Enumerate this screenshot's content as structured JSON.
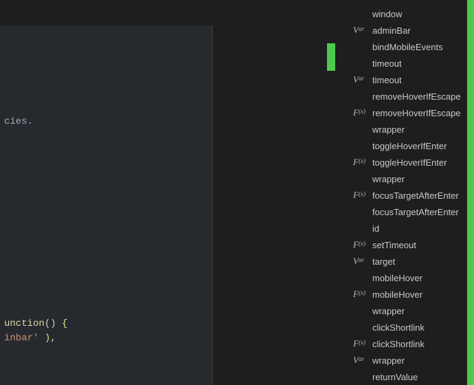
{
  "editor": {
    "lines": [
      {
        "text": "",
        "cls": ""
      },
      {
        "text": "",
        "cls": ""
      },
      {
        "text": "",
        "cls": ""
      },
      {
        "text": "",
        "cls": ""
      },
      {
        "text": "",
        "cls": ""
      },
      {
        "text": "",
        "cls": ""
      },
      {
        "text": "cies.",
        "cls": "tok-comment"
      },
      {
        "text": "",
        "cls": ""
      },
      {
        "text": "",
        "cls": ""
      },
      {
        "text": "",
        "cls": ""
      },
      {
        "text": "",
        "cls": ""
      },
      {
        "text": "",
        "cls": ""
      },
      {
        "text": "",
        "cls": ""
      },
      {
        "text": "",
        "cls": ""
      },
      {
        "text": "",
        "cls": ""
      },
      {
        "text": "",
        "cls": ""
      },
      {
        "text": "",
        "cls": ""
      },
      {
        "text": "",
        "cls": ""
      },
      {
        "text": "",
        "cls": ""
      },
      {
        "text": "",
        "cls": ""
      },
      {
        "text": "unction() {",
        "cls": "funcline"
      },
      {
        "text": "inbar' ),",
        "cls": "strline"
      }
    ]
  },
  "outline": {
    "items": [
      {
        "kind": "none",
        "label": "window"
      },
      {
        "kind": "var",
        "label": "adminBar"
      },
      {
        "kind": "none",
        "label": "bindMobileEvents"
      },
      {
        "kind": "none",
        "label": "timeout"
      },
      {
        "kind": "var",
        "label": "timeout"
      },
      {
        "kind": "none",
        "label": "removeHoverIfEscape"
      },
      {
        "kind": "fx",
        "label": "removeHoverIfEscape"
      },
      {
        "kind": "none",
        "label": "wrapper"
      },
      {
        "kind": "none",
        "label": "toggleHoverIfEnter"
      },
      {
        "kind": "fx",
        "label": "toggleHoverIfEnter"
      },
      {
        "kind": "none",
        "label": "wrapper"
      },
      {
        "kind": "fx",
        "label": "focusTargetAfterEnter"
      },
      {
        "kind": "none",
        "label": "focusTargetAfterEnter"
      },
      {
        "kind": "none",
        "label": "id"
      },
      {
        "kind": "fx",
        "label": "setTimeout"
      },
      {
        "kind": "var",
        "label": "target"
      },
      {
        "kind": "none",
        "label": "mobileHover"
      },
      {
        "kind": "fx",
        "label": "mobileHover"
      },
      {
        "kind": "none",
        "label": "wrapper"
      },
      {
        "kind": "none",
        "label": "clickShortlink"
      },
      {
        "kind": "fx",
        "label": "clickShortlink"
      },
      {
        "kind": "var",
        "label": "wrapper"
      },
      {
        "kind": "none",
        "label": "returnValue"
      }
    ]
  }
}
